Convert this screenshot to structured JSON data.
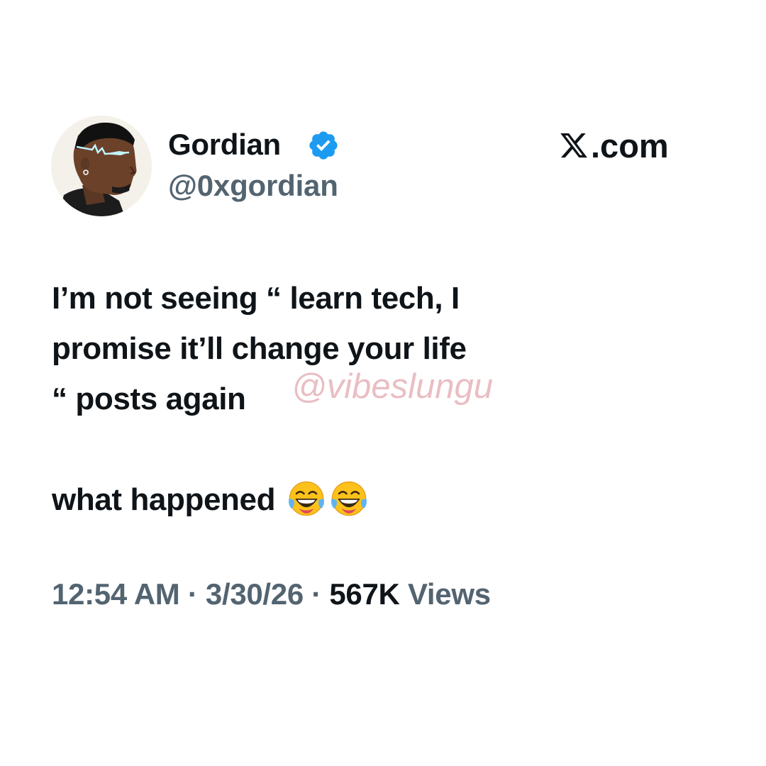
{
  "author": {
    "display_name": "Gordian",
    "handle": "@0xgordian",
    "verified_icon": "verified-badge-icon",
    "avatar_icon": "cartoon-man-avatar"
  },
  "brand": {
    "logo_icon": "x-logo-icon",
    "text": ".com"
  },
  "tweet": {
    "lines": [
      "I’m not seeing “ learn tech, I",
      "promise it’ll change your life",
      "“ posts again"
    ],
    "second_paragraph": "what happened",
    "emoji_icon": "face-with-tears-of-joy-icon",
    "emoji_count": 2
  },
  "watermark": "@vibeslungu",
  "meta": {
    "time": "12:54 AM",
    "sep1": " · ",
    "date": "3/30/26",
    "sep2": " · ",
    "views_count": "567K",
    "views_label": " Views"
  },
  "colors": {
    "text_primary": "#0f1419",
    "text_secondary": "#536471",
    "verified_blue": "#1d9bf0",
    "watermark_pink": "#dc969e"
  }
}
